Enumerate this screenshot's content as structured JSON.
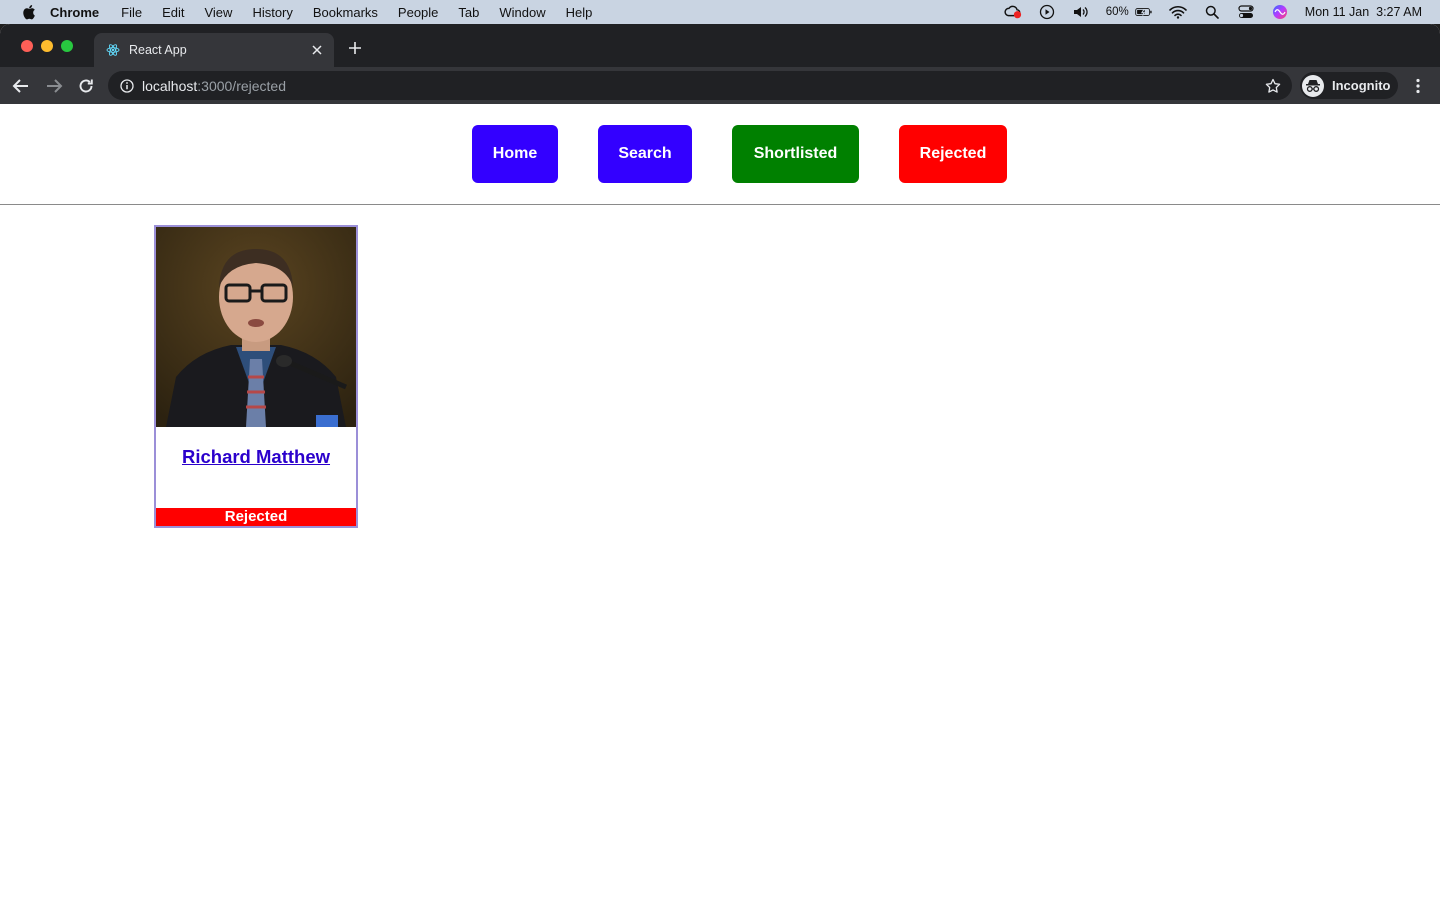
{
  "menubar": {
    "app": "Chrome",
    "items": [
      "File",
      "Edit",
      "View",
      "History",
      "Bookmarks",
      "People",
      "Tab",
      "Window",
      "Help"
    ],
    "battery_percent": "60%",
    "datetime": "Mon 11 Jan  3:27 AM"
  },
  "browser": {
    "tab_title": "React App",
    "url_host": "localhost",
    "url_path": ":3000/rejected",
    "profile_label": "Incognito"
  },
  "nav": {
    "home": "Home",
    "search": "Search",
    "shortlisted": "Shortlisted",
    "rejected": "Rejected"
  },
  "candidates": [
    {
      "name": "Richard Matthew",
      "status": "Rejected"
    }
  ],
  "colors": {
    "nav_primary": "#3300ff",
    "nav_shortlisted": "#008000",
    "nav_rejected": "#ff0000",
    "status_rejected": "#ff0000"
  }
}
